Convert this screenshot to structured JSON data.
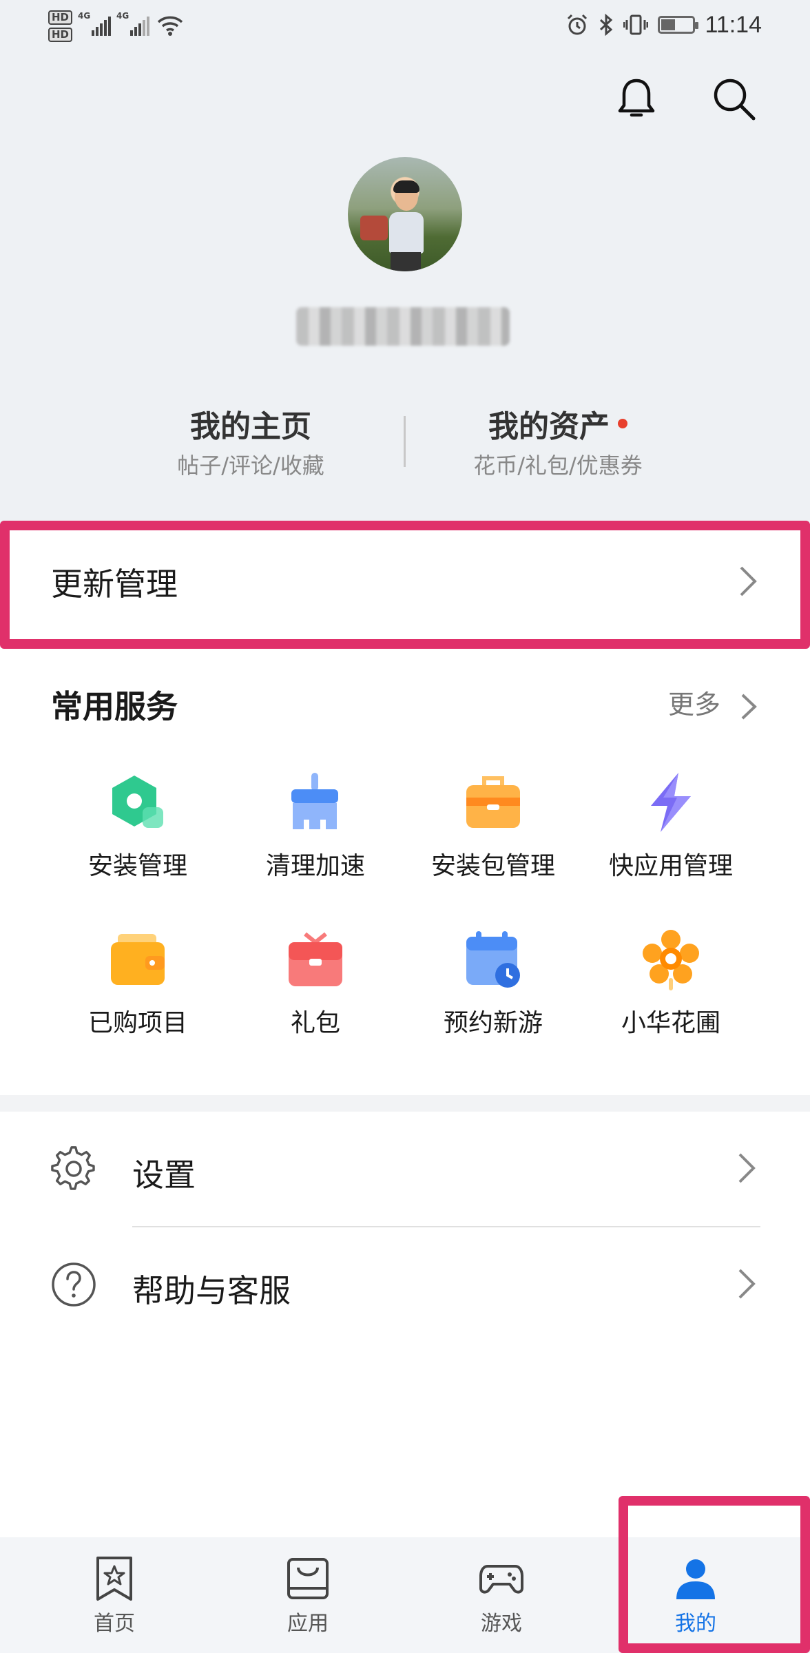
{
  "status_bar": {
    "time": "11:14",
    "hd1": "HD",
    "hd2": "HD",
    "net1": "4G",
    "net2": "4G"
  },
  "header": {
    "notification_icon": "bell-icon",
    "search_icon": "search-icon"
  },
  "profile": {
    "avatar": "user-avatar",
    "username": ""
  },
  "stats": {
    "home": {
      "title": "我的主页",
      "subtitle": "帖子/评论/收藏"
    },
    "assets": {
      "title": "我的资产",
      "subtitle": "花币/礼包/优惠券",
      "has_dot": true
    }
  },
  "update_management": {
    "label": "更新管理"
  },
  "services": {
    "title": "常用服务",
    "more_label": "更多",
    "items": [
      {
        "label": "安装管理",
        "icon": "install-manage-icon",
        "color": "#2fc98f"
      },
      {
        "label": "清理加速",
        "icon": "broom-icon",
        "color": "#4c8df6"
      },
      {
        "label": "安装包管理",
        "icon": "package-icon",
        "color": "#ff9a1f"
      },
      {
        "label": "快应用管理",
        "icon": "lightning-icon",
        "color": "#7b6cf5"
      },
      {
        "label": "已购项目",
        "icon": "wallet-icon",
        "color": "#ffb020"
      },
      {
        "label": "礼包",
        "icon": "gift-icon",
        "color": "#f45656"
      },
      {
        "label": "预约新游",
        "icon": "calendar-clock-icon",
        "color": "#4c8df6"
      },
      {
        "label": "小华花圃",
        "icon": "flower-icon",
        "color": "#ff9a1f"
      }
    ]
  },
  "settings_list": [
    {
      "label": "设置",
      "icon": "gear-icon"
    },
    {
      "label": "帮助与客服",
      "icon": "help-icon"
    }
  ],
  "bottom_nav": [
    {
      "label": "首页",
      "icon": "home-star-icon",
      "active": false
    },
    {
      "label": "应用",
      "icon": "app-bag-icon",
      "active": false
    },
    {
      "label": "游戏",
      "icon": "gamepad-icon",
      "active": false
    },
    {
      "label": "我的",
      "icon": "person-icon",
      "active": true
    }
  ],
  "colors": {
    "accent": "#1473e6",
    "highlight": "#e0306a",
    "header_bg": "#eef1f4"
  }
}
